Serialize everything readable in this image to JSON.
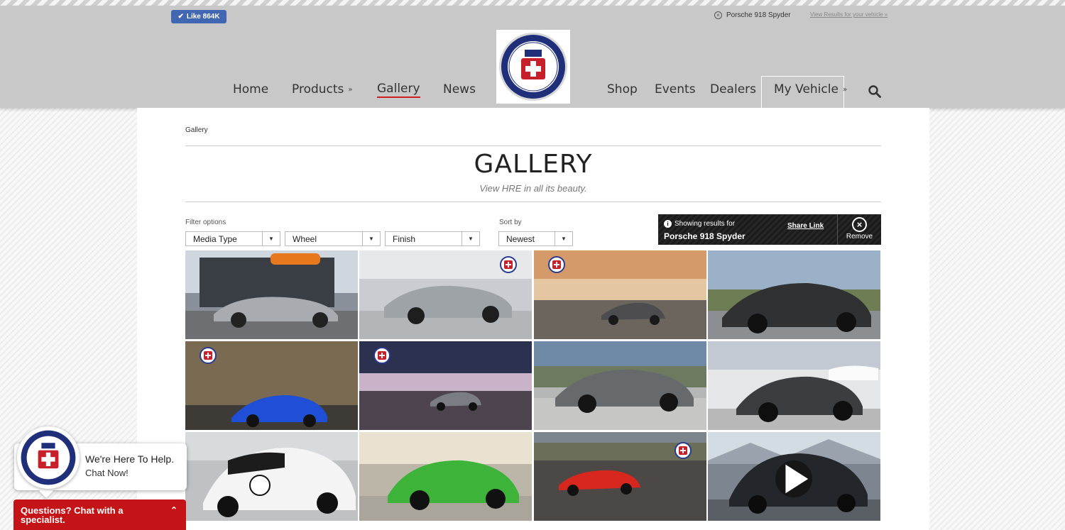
{
  "header": {
    "like_label": "Like 864K",
    "vehicle_name": "Porsche 918 Spyder",
    "view_results": "View Results for your vehicle »",
    "logo_alt": "HRE PERFORMANCE WHEELS",
    "logo_center": "HRE",
    "nav_left": [
      {
        "label": "Home"
      },
      {
        "label": "Products"
      },
      {
        "label": "Gallery"
      },
      {
        "label": "News"
      }
    ],
    "nav_right": [
      {
        "label": "Shop"
      },
      {
        "label": "Events"
      },
      {
        "label": "Dealers"
      },
      {
        "label": "My Vehicle"
      }
    ]
  },
  "page": {
    "breadcrumb": "Gallery",
    "title": "GALLERY",
    "subtitle": "View HRE in all its beauty."
  },
  "filters": {
    "filter_label": "Filter options",
    "sort_label": "Sort by",
    "media_type": "Media Type",
    "wheel": "Wheel",
    "finish": "Finish",
    "sort_value": "Newest"
  },
  "results": {
    "showing": "Showing results for",
    "vehicle": "Porsche 918 Spyder",
    "share": "Share Link",
    "remove": "Remove"
  },
  "chat": {
    "line1": "We're Here To Help.",
    "line2": "Chat Now!",
    "bar": "Questions? Chat with a specialist."
  },
  "colors": {
    "header_bg": "#c8c8c8",
    "accent_red": "#c41418",
    "fb_blue": "#4267b2"
  }
}
